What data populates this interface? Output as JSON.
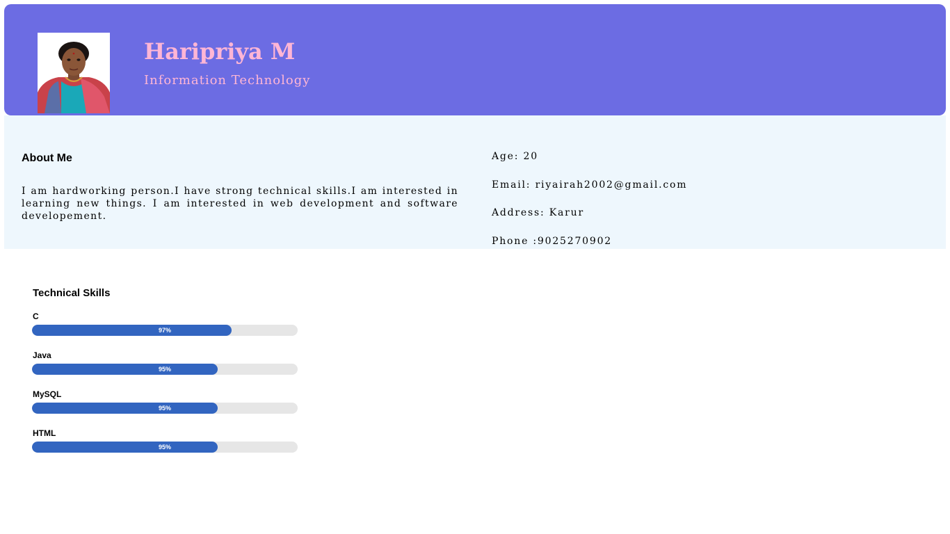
{
  "header": {
    "name": "Haripriya M",
    "department": "Information Technology",
    "background_color": "#6c6ce3",
    "text_color": "#ffb6d5",
    "photo_icon": "profile-photo"
  },
  "about": {
    "title": "About Me",
    "text": "I am hardworking person.I have strong technical skills.I am interested in learning new things. I am interested in web development and software developement.",
    "background_color": "#eef7fd"
  },
  "info": {
    "age": "Age: 20",
    "email": "Email: riyairah2002@gmail.com",
    "address": "Address: Karur",
    "phone": "Phone :9025270902"
  },
  "skills": {
    "title": "Technical Skills",
    "bar_color": "#3265c0",
    "track_color": "#e6e6e6",
    "items": [
      {
        "name": "C",
        "label": "97%",
        "fill_percent": 75
      },
      {
        "name": "Java",
        "label": "95%",
        "fill_percent": 70
      },
      {
        "name": "MySQL",
        "label": "95%",
        "fill_percent": 70
      },
      {
        "name": "HTML",
        "label": "95%",
        "fill_percent": 70
      }
    ]
  }
}
